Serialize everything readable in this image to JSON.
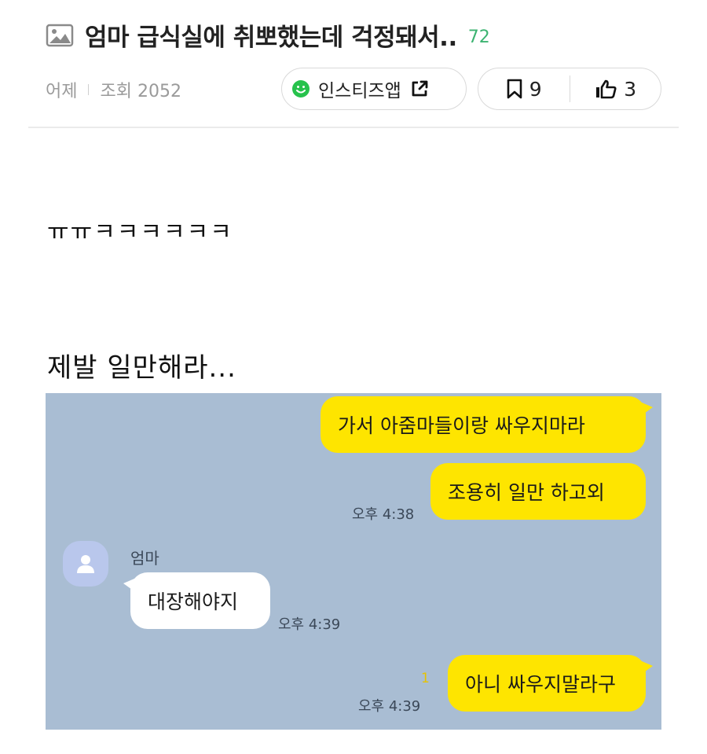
{
  "header": {
    "title": "엄마 급식실에 취뽀했는데 걱정돼서..",
    "comment_count": "72",
    "posted": "어제",
    "views": "조회 2052",
    "app_label": "인스티즈앱",
    "bookmarks": "9",
    "likes": "3",
    "icons": [
      "image-icon",
      "smile-icon",
      "share-icon",
      "bookmark-icon",
      "thumbs-up-icon"
    ]
  },
  "body": {
    "line1": "ㅠㅠㅋㅋㅋㅋㅋㅋ",
    "line2": "제발 일만해라..."
  },
  "chat": {
    "background": "#a9bdd3",
    "my_bubble_color": "#fee500",
    "messages": [
      {
        "text": "가서 아줌마들이랑 싸우지마라"
      },
      {
        "text": "조용히 일만 하고외",
        "time": "오후 4:38"
      },
      {
        "sender": "엄마",
        "text": "대장해야지",
        "time": "오후 4:39"
      },
      {
        "text": "아니 싸우지말라구",
        "time": "오후 4:39",
        "unread": "1"
      }
    ]
  }
}
